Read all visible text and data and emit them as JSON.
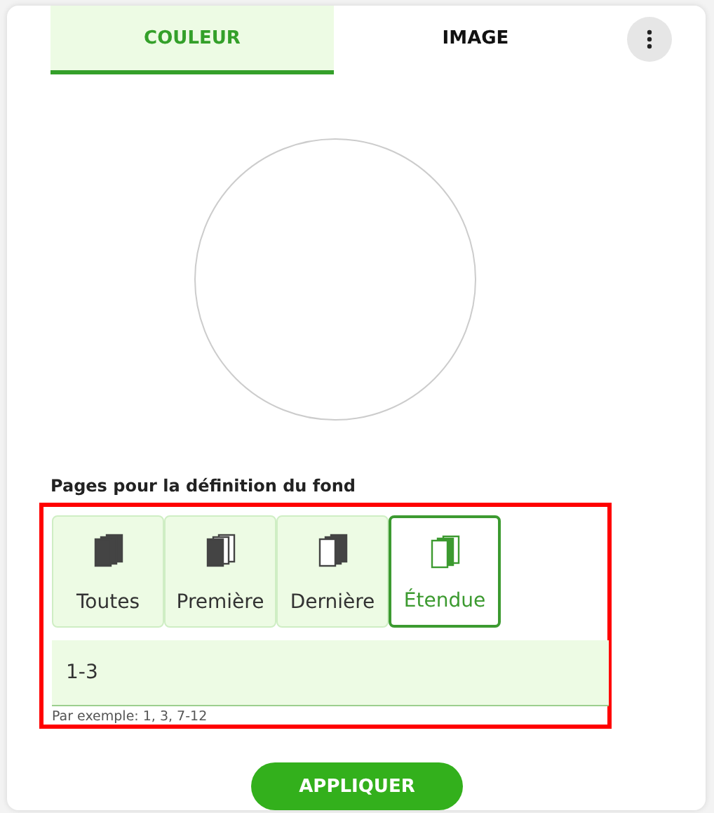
{
  "tabs": [
    {
      "label": "COULEUR",
      "selected": true
    },
    {
      "label": "IMAGE",
      "selected": false
    }
  ],
  "color_preview": {
    "kind": "empty"
  },
  "pages": {
    "label": "Pages pour la définition du fond",
    "options": [
      {
        "label": "Toutes",
        "kind": "all",
        "selected": false
      },
      {
        "label": "Première",
        "kind": "first",
        "selected": false
      },
      {
        "label": "Dernière",
        "kind": "last",
        "selected": false
      },
      {
        "label": "Étendue",
        "kind": "range",
        "selected": true
      }
    ],
    "range_value": "1-3",
    "hint": "Par exemple: 1, 3, 7-12"
  },
  "apply_button": "APPLIQUER"
}
